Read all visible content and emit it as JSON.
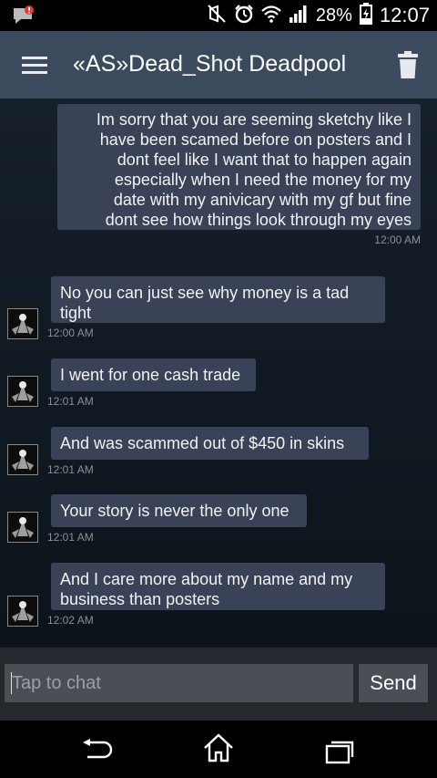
{
  "status_bar": {
    "battery_percent": "28%",
    "time": "12:07",
    "icons": [
      "notification-icon",
      "mute-icon",
      "alarm-icon",
      "wifi-icon",
      "signal-icon",
      "battery-charging-icon"
    ]
  },
  "header": {
    "title": "«AS»Dead_Shot Deadpool",
    "menu_icon": "hamburger-menu-icon",
    "delete_icon": "trash-icon"
  },
  "messages": [
    {
      "direction": "sent",
      "lines": [
        "Im sorry that you are seeming sketchy like I",
        "have been scamed before on posters and I",
        "dont feel like I want that to happen again",
        "especially when I need the money for my",
        "date with my anivicary with my gf but fine",
        "dont see how things look through my eyes"
      ],
      "time": "12:00 AM"
    },
    {
      "direction": "received",
      "lines": [
        "No you can just see why money is a tad",
        "tight"
      ],
      "time": "12:00 AM"
    },
    {
      "direction": "received",
      "lines": [
        "I went for one cash trade"
      ],
      "time": "12:01 AM"
    },
    {
      "direction": "received",
      "lines": [
        "And was scammed out of $450 in skins"
      ],
      "time": "12:01 AM"
    },
    {
      "direction": "received",
      "lines": [
        "Your story is never the only one"
      ],
      "time": "12:01 AM"
    },
    {
      "direction": "received",
      "lines": [
        "And I care more about my name and my",
        "business than posters"
      ],
      "time": "12:02 AM"
    }
  ],
  "composer": {
    "placeholder": "Tap to chat",
    "value": "",
    "send_label": "Send"
  },
  "nav": {
    "icons": [
      "back-icon",
      "home-icon",
      "recent-apps-icon"
    ]
  }
}
